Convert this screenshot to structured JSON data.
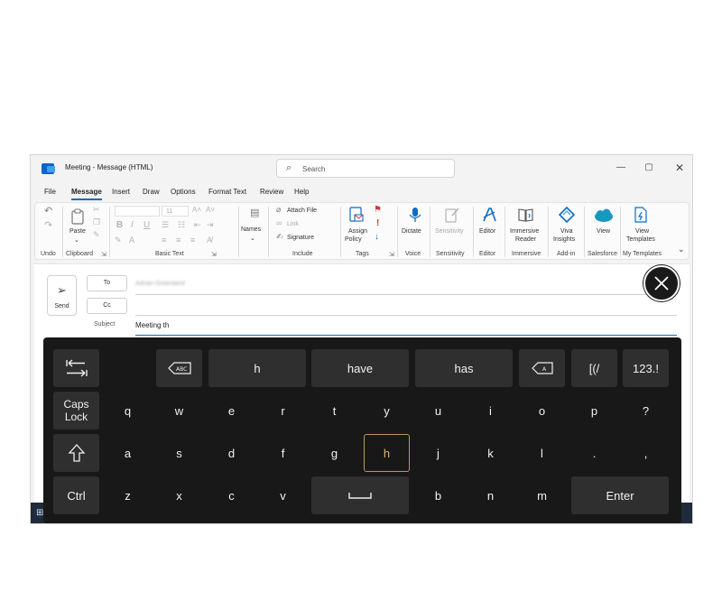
{
  "window": {
    "title": "Meeting  -  Message (HTML)",
    "search_placeholder": "Search",
    "controls": {
      "minimize": "—",
      "maximize": "▢",
      "close": "✕"
    }
  },
  "menu": {
    "tabs": [
      "File",
      "Message",
      "Insert",
      "Draw",
      "Options",
      "Format Text",
      "Review",
      "Help"
    ],
    "active": "Message"
  },
  "ribbon": {
    "groups": {
      "undo": "Undo",
      "clipboard": "Clipboard",
      "basic_text": "Basic Text",
      "include": "Include",
      "tags": "Tags",
      "voice": "Voice",
      "sensitivity": "Sensitivity",
      "editor": "Editor",
      "immersive": "Immersive",
      "add_in": "Add-in",
      "salesforce": "Salesforce",
      "my_templates": "My Templates"
    },
    "buttons": {
      "paste": "Paste",
      "names": "Names",
      "attach_file": "Attach File",
      "link": "Link",
      "signature": "Signature",
      "assign_policy_1": "Assign",
      "assign_policy_2": "Policy",
      "dictate": "Dictate",
      "sensitivity": "Sensitivity",
      "editor": "Editor",
      "immersive_1": "Immersive",
      "immersive_2": "Reader",
      "viva_1": "Viva",
      "viva_2": "Insights",
      "view": "View",
      "view_templates_1": "View",
      "view_templates_2": "Templates",
      "font_size": "11"
    },
    "colors": {
      "accent": "#0f6cbd",
      "flag": "#d13438"
    }
  },
  "compose": {
    "send": "Send",
    "to": "To",
    "cc": "Cc",
    "to_value": "Adrian Greenland",
    "subject_label": "Subject",
    "subject_value": "Meeting th"
  },
  "keyboard": {
    "row1": {
      "tab_icon": "tab-icon",
      "delete_word_icon": "delete-word-icon",
      "suggestions": [
        "h",
        "have",
        "has"
      ],
      "backspace_icon": "backspace-icon",
      "symbols": "[(/",
      "numbers": "123.!"
    },
    "row2": {
      "caps_1": "Caps",
      "caps_2": "Lock",
      "keys": [
        "q",
        "w",
        "e",
        "r",
        "t",
        "y",
        "u",
        "i",
        "o",
        "p",
        "?"
      ]
    },
    "row3": {
      "shift_icon": "shift-icon",
      "keys": [
        "a",
        "s",
        "d",
        "f",
        "g",
        "h",
        "j",
        "k",
        "l",
        ".",
        ","
      ],
      "focused": "h"
    },
    "row4": {
      "ctrl": "Ctrl",
      "keys_left": [
        "z",
        "x",
        "c",
        "v"
      ],
      "space_icon": "space-icon",
      "keys_right": [
        "b",
        "n",
        "m"
      ],
      "enter": "Enter"
    },
    "colors": {
      "background": "#181818",
      "key": "#2f2f2f",
      "focus": "#b89a5a"
    }
  }
}
